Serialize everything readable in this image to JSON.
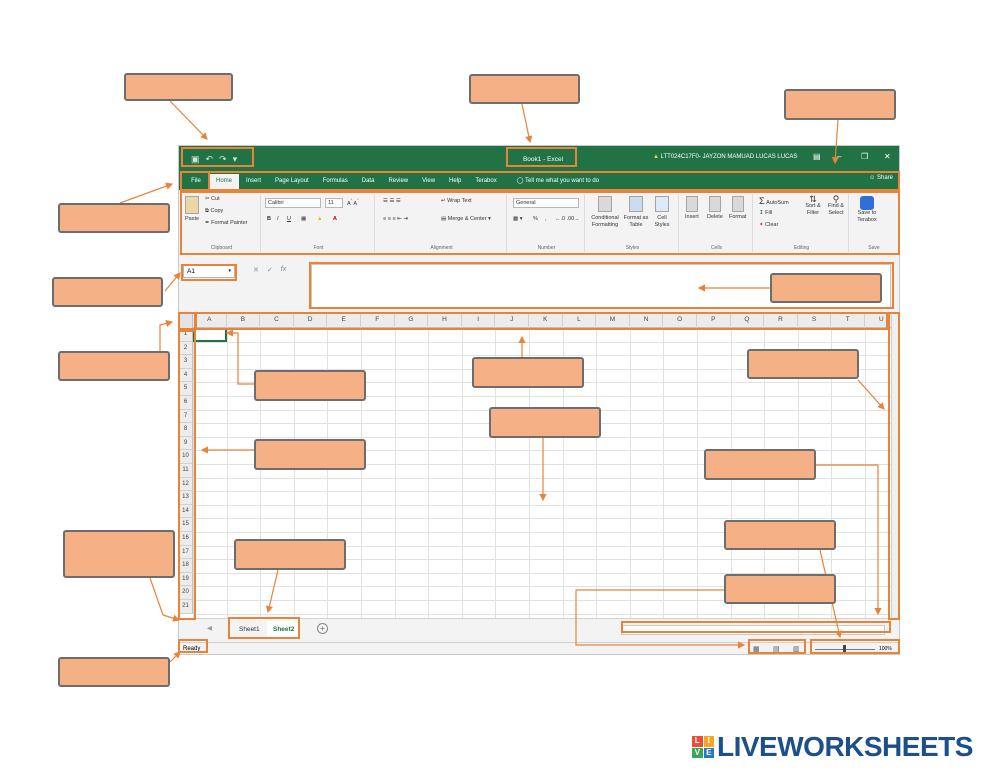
{
  "title_bar": {
    "qat_icons": [
      "save-icon",
      "undo-icon",
      "redo-icon",
      "customize-icon"
    ],
    "book_title": "Book1 - Excel",
    "user": "LTT024C17F0- JAYZON MAMUAD LUCAS LUCAS",
    "window_buttons": [
      "ribbon-display-icon",
      "minimize-icon",
      "restore-icon",
      "close-icon"
    ]
  },
  "tabs": [
    "File",
    "Home",
    "Insert",
    "Page Layout",
    "Formulas",
    "Data",
    "Review",
    "View",
    "Help",
    "Terabox"
  ],
  "tell_me": "Tell me what you want to do",
  "share": "Share",
  "ribbon": {
    "clipboard": {
      "paste": "Paste",
      "cut": "Cut",
      "copy": "Copy",
      "format_painter": "Format Painter",
      "name": "Clipboard"
    },
    "font": {
      "font_name": "Calibri",
      "font_size": "11",
      "bold": "B",
      "italic": "I",
      "underline": "U",
      "name": "Font"
    },
    "alignment": {
      "wrap": "Wrap Text",
      "merge": "Merge & Center",
      "name": "Alignment"
    },
    "number": {
      "format": "General",
      "percent": "%",
      "name": "Number"
    },
    "styles": {
      "conditional": "Conditional Formatting",
      "format_table": "Format as Table",
      "cell_styles": "Cell Styles",
      "name": "Styles"
    },
    "cells": {
      "insert": "Insert",
      "delete": "Delete",
      "format": "Format",
      "name": "Cells"
    },
    "editing": {
      "autosum": "AutoSum",
      "fill": "Fill",
      "clear": "Clear",
      "sort": "Sort & Filter",
      "find": "Find & Select",
      "name": "Editing"
    },
    "save": {
      "label": "Save to Terabox",
      "name": "Save"
    }
  },
  "formula_bar": {
    "name_box": "A1",
    "fx": "fx"
  },
  "columns": [
    "A",
    "B",
    "C",
    "D",
    "E",
    "F",
    "G",
    "H",
    "I",
    "J",
    "K",
    "L",
    "M",
    "N",
    "O",
    "P",
    "Q",
    "R",
    "S",
    "T",
    "U"
  ],
  "rows": [
    "1",
    "2",
    "3",
    "4",
    "5",
    "6",
    "7",
    "8",
    "9",
    "10",
    "11",
    "12",
    "13",
    "14",
    "15",
    "16",
    "17",
    "18",
    "19",
    "20",
    "21"
  ],
  "sheets": [
    "Sheet1",
    "Sheet2"
  ],
  "status": {
    "ready": "Ready",
    "zoom": "100%"
  },
  "worksheet_branding": {
    "logo_letters": [
      "L",
      "I",
      "V",
      "E"
    ],
    "wordmark": "LIVEWORKSHEETS"
  },
  "colors": {
    "excel_green": "#217346",
    "highlight_orange": "#e8833a",
    "label_fill": "#f5b185"
  }
}
